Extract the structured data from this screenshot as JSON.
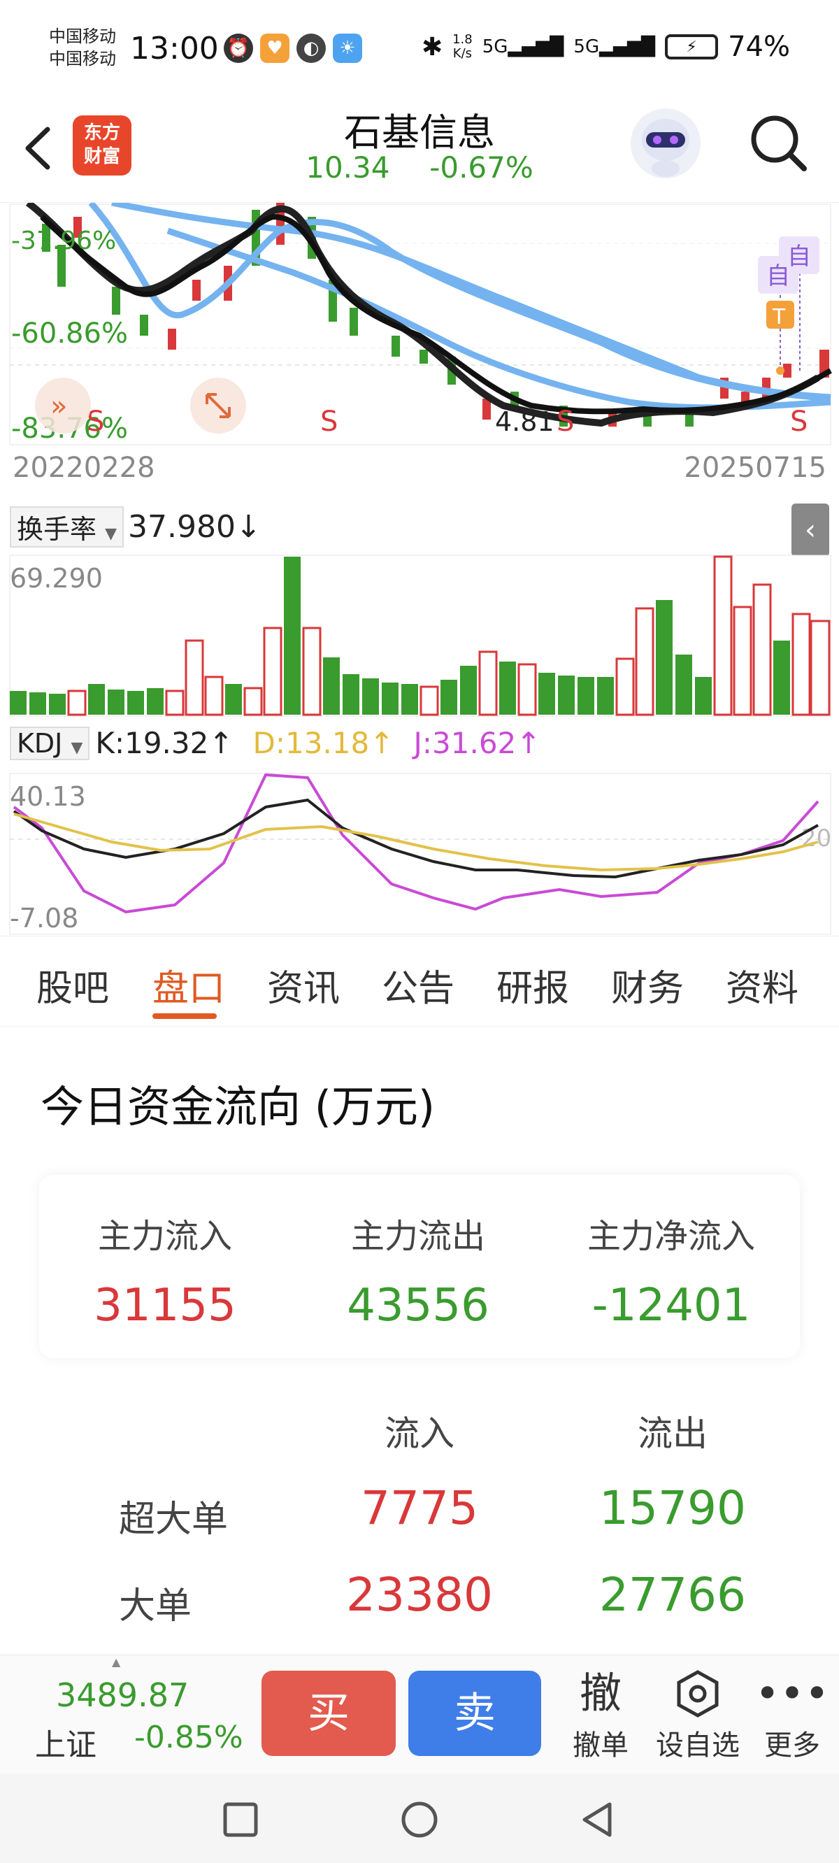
{
  "status_bar": {
    "carrier_1": "中国移动",
    "carrier_2": "中国移动",
    "time": "13:00",
    "net_speed_value": "1.8",
    "net_speed_unit": "K/s",
    "battery": "74%"
  },
  "header": {
    "logo_line1": "东方",
    "logo_line2": "财富",
    "stock_name": "石基信息",
    "price": "10.34",
    "change": "-0.67%"
  },
  "kline": {
    "pct_labels": [
      "-37.96%",
      "-60.86%",
      "-83.76%"
    ],
    "sell_marker": "S",
    "low_label": "4.81",
    "self_select_marker": "自",
    "start_date": "20220228",
    "end_date": "20250715"
  },
  "turnover": {
    "selector": "换手率",
    "value": "37.980",
    "max_label": "69.290"
  },
  "kdj": {
    "selector": "KDJ",
    "k_label": "K:19.32",
    "d_label": "D:13.18",
    "j_label": "J:31.62",
    "upper_label": "40.13",
    "lower_label": "-7.08",
    "ref_label": "20"
  },
  "tabs": [
    "股吧",
    "盘口",
    "资讯",
    "公告",
    "研报",
    "财务",
    "资料"
  ],
  "active_tab": "盘口",
  "capital_flow": {
    "title": "今日资金流向 (万元)",
    "summary": [
      {
        "label": "主力流入",
        "value": "31155"
      },
      {
        "label": "主力流出",
        "value": "43556"
      },
      {
        "label": "主力净流入",
        "value": "-12401"
      }
    ],
    "table_headers": {
      "inflow": "流入",
      "outflow": "流出"
    },
    "rows": [
      {
        "label": "超大单",
        "inflow": "7775",
        "outflow": "15790"
      },
      {
        "label": "大单",
        "inflow": "23380",
        "outflow": "27766"
      }
    ]
  },
  "trade_bar": {
    "index_value": "3489.87",
    "index_name": "上证",
    "index_change": "-0.85%",
    "buy": "买",
    "sell": "卖",
    "cancel_icon": "撤",
    "cancel": "撤单",
    "watchlist": "设自选",
    "more": "更多"
  },
  "colors": {
    "up": "#d8383a",
    "down": "#3a9b2e",
    "accent": "#e05a22",
    "ma_blue": "#74b3ef"
  }
}
